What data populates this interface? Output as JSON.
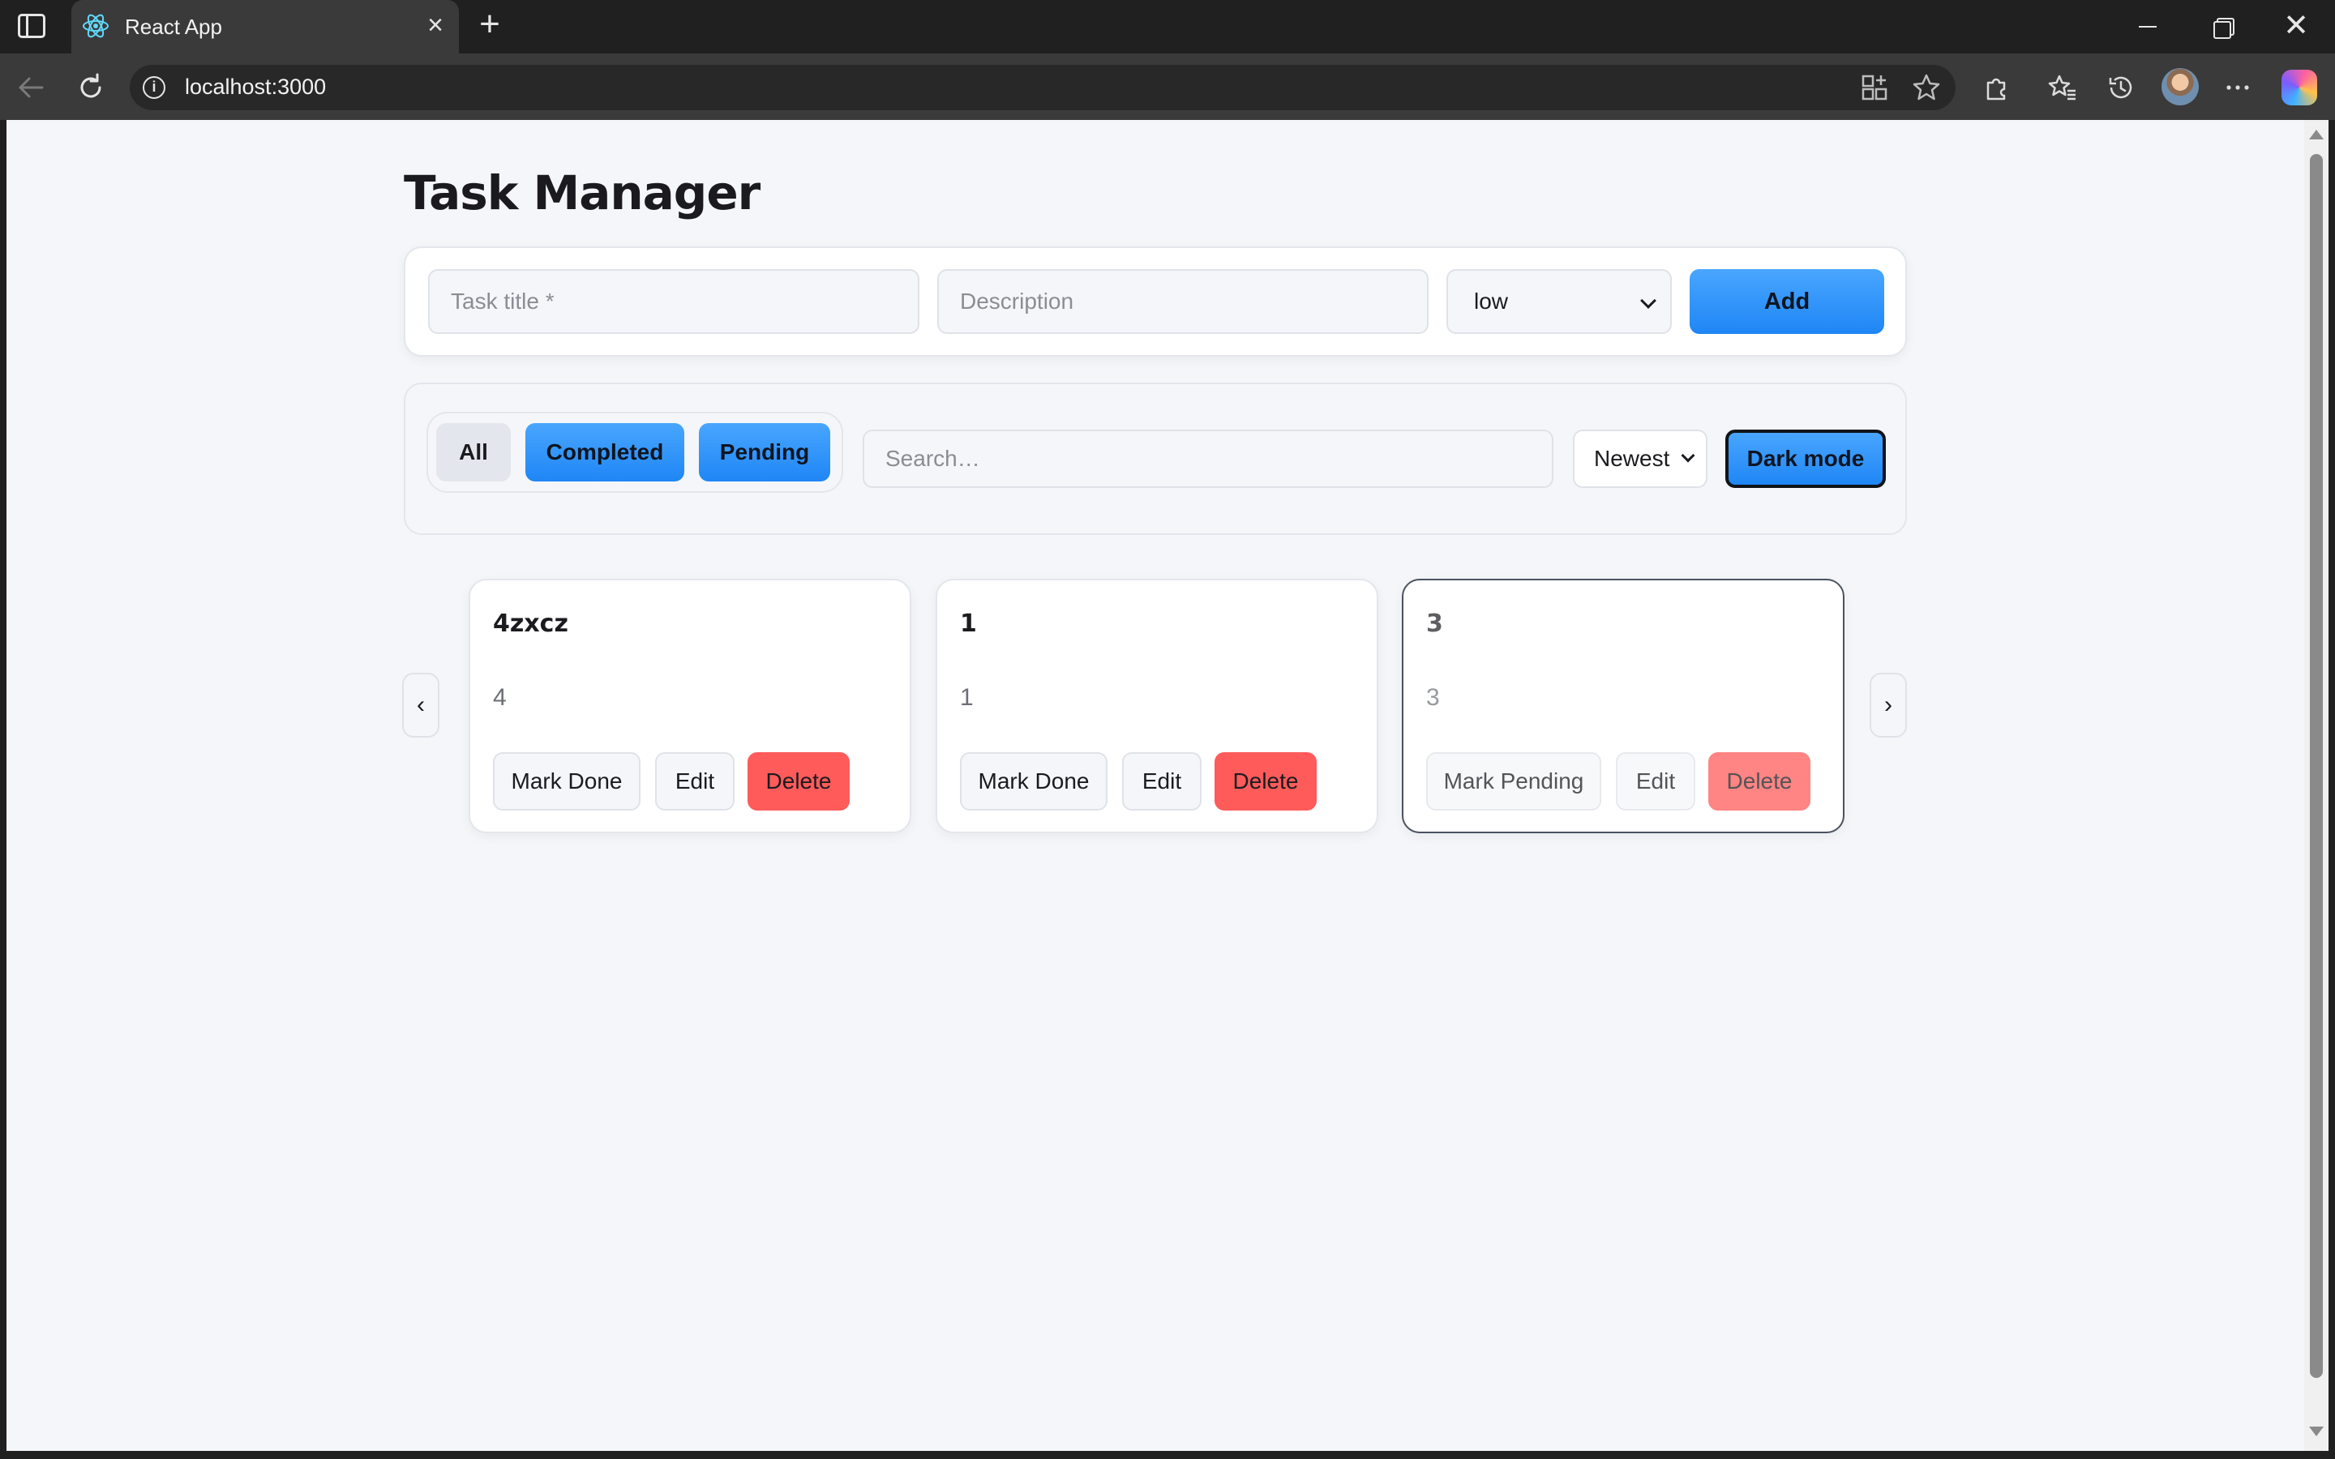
{
  "browser": {
    "tab_title": "React App",
    "url": "localhost:3000",
    "tab_close": "×",
    "new_tab": "+",
    "win_close": "✕"
  },
  "page": {
    "title": "Task Manager"
  },
  "add_form": {
    "title_placeholder": "Task title *",
    "description_placeholder": "Description",
    "priority_value": "low",
    "add_label": "Add"
  },
  "filters": {
    "all_label": "All",
    "completed_label": "Completed",
    "pending_label": "Pending",
    "active_filter": "All",
    "search_placeholder": "Search…",
    "sort_value": "Newest",
    "dark_mode_label": "Dark mode"
  },
  "carousel": {
    "prev": "‹",
    "next": "›"
  },
  "tasks": [
    {
      "title": "4zxcz",
      "description": "4",
      "toggle_label": "Mark Done",
      "edit_label": "Edit",
      "delete_label": "Delete",
      "completed": false
    },
    {
      "title": "1",
      "description": "1",
      "toggle_label": "Mark Done",
      "edit_label": "Edit",
      "delete_label": "Delete",
      "completed": false
    },
    {
      "title": "3",
      "description": "3",
      "toggle_label": "Mark Pending",
      "edit_label": "Edit",
      "delete_label": "Delete",
      "completed": true
    }
  ],
  "colors": {
    "accent_blue": "#2b8ff8",
    "delete_red": "#ff5b5b",
    "page_bg": "#f5f6f9"
  },
  "icons": [
    "sidebar-toggle-icon",
    "react-icon",
    "back-icon",
    "reload-icon",
    "info-icon",
    "apps-icon",
    "star-icon",
    "extensions-icon",
    "favorites-icon",
    "history-icon",
    "more-icon",
    "copilot-icon"
  ]
}
